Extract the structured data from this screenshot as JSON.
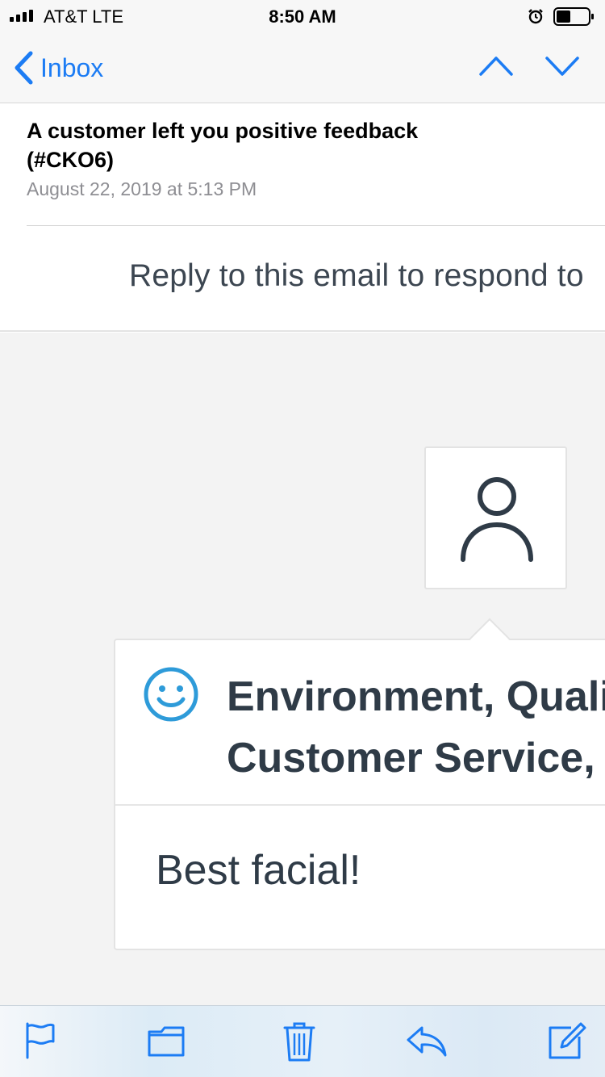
{
  "status_bar": {
    "carrier": "AT&T   LTE",
    "time": "8:50 AM",
    "icons": [
      "signal-icon",
      "alarm-icon",
      "battery-icon"
    ]
  },
  "nav": {
    "back_label": "Inbox",
    "icons": [
      "chevron-left-icon",
      "chevron-up-icon",
      "chevron-down-icon"
    ]
  },
  "email": {
    "subject": "A customer left you positive feedback (#CKO6)",
    "date": "August 22, 2019 at 5:13 PM",
    "reply_text": "Reply to this email to respond to"
  },
  "feedback": {
    "categories": "Environment, Quality,\nCustomer Service,",
    "comment": "Best facial!",
    "icons": [
      "person-icon",
      "smile-icon"
    ]
  },
  "toolbar": {
    "icons": [
      "flag-icon",
      "folder-icon",
      "trash-icon",
      "reply-icon",
      "compose-icon"
    ]
  },
  "colors": {
    "accent": "#1c7cf4",
    "text_dark": "#2f3b47",
    "smile": "#2e9bd9"
  }
}
